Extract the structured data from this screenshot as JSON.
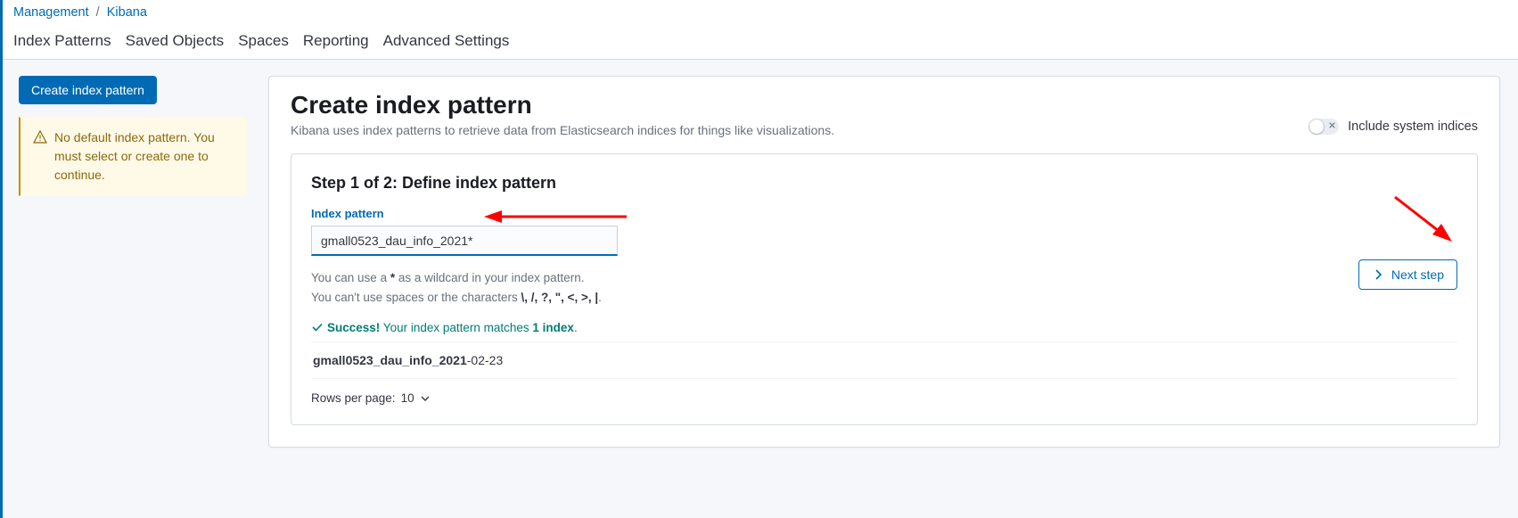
{
  "breadcrumbs": {
    "root": "Management",
    "current": "Kibana"
  },
  "tabs": {
    "index_patterns": "Index Patterns",
    "saved_objects": "Saved Objects",
    "spaces": "Spaces",
    "reporting": "Reporting",
    "advanced_settings": "Advanced Settings"
  },
  "sidebar": {
    "create_btn": "Create index pattern",
    "warning": "No default index pattern. You must select or create one to continue."
  },
  "header": {
    "title": "Create index pattern",
    "subtitle": "Kibana uses index patterns to retrieve data from Elasticsearch indices for things like visualizations.",
    "include_sys_label": "Include system indices"
  },
  "step": {
    "title": "Step 1 of 2: Define index pattern",
    "field_label": "Index pattern",
    "field_value": "gmall0523_dau_info_2021*",
    "hint1_pre": "You can use a ",
    "hint1_star": "*",
    "hint1_post": " as a wildcard in your index pattern.",
    "hint2_pre": "You can't use spaces or the characters ",
    "hint2_chars": "\\, /, ?, \", <, >, |",
    "hint2_post": ".",
    "success_label": "Success!",
    "success_text": " Your index pattern matches ",
    "success_count": "1 index",
    "success_suffix": ".",
    "match_bold": "gmall0523_dau_info_2021",
    "match_rest": "-02-23",
    "rows_label": "Rows per page: ",
    "rows_value": "10",
    "next_label": "Next step"
  }
}
